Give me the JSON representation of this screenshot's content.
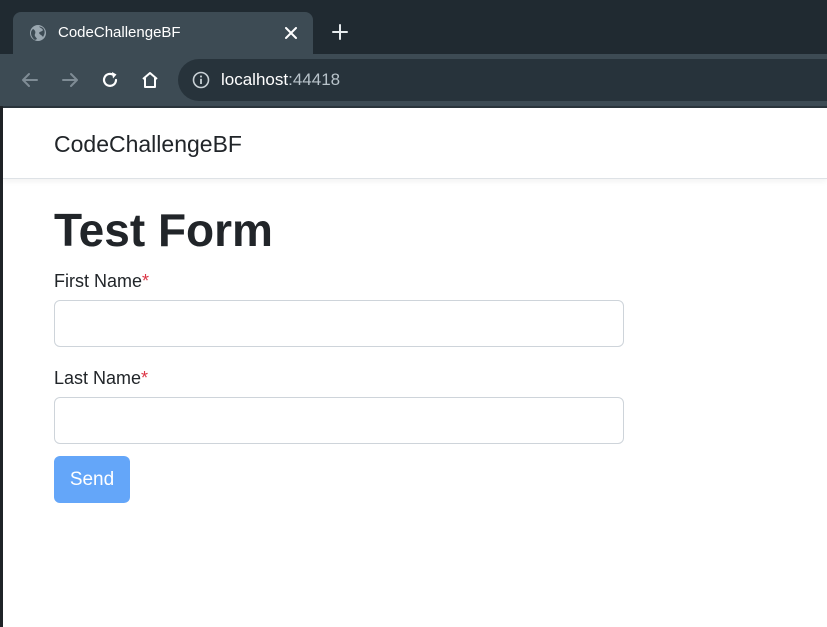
{
  "browser": {
    "tab": {
      "title": "CodeChallengeBF"
    },
    "omnibox": {
      "host": "localhost",
      "port": ":44418"
    },
    "colors": {
      "tabstrip": "#202a31",
      "toolbar": "#3d4b54",
      "omnibox": "#27333b"
    }
  },
  "navbar": {
    "brand": "CodeChallengeBF"
  },
  "form": {
    "title": "Test Form",
    "fields": [
      {
        "label": "First Name",
        "required_mark": "*",
        "value": ""
      },
      {
        "label": "Last Name",
        "required_mark": "*",
        "value": ""
      }
    ],
    "submit_label": "Send"
  },
  "colors": {
    "submit": "#64a6f9",
    "required": "#dc3545",
    "text": "#212529"
  },
  "icons": [
    "globe-icon",
    "close-icon",
    "plus-icon",
    "back-arrow-icon",
    "forward-arrow-icon",
    "reload-icon",
    "home-icon",
    "info-icon"
  ]
}
